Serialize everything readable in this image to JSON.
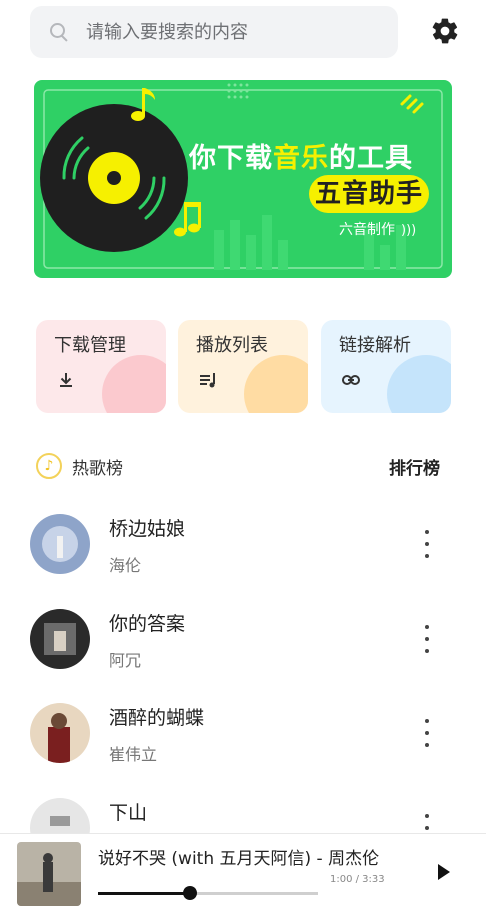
{
  "search": {
    "placeholder": "请输入要搜索的内容"
  },
  "banner": {
    "line1_a": "你下载",
    "line1_b": "音乐",
    "line1_c": "的工具",
    "badge": "五音助手",
    "maker": "六音制作"
  },
  "features": [
    {
      "label": "下载管理",
      "icon": "download-icon"
    },
    {
      "label": "播放列表",
      "icon": "playlist-icon"
    },
    {
      "label": "链接解析",
      "icon": "link-icon"
    }
  ],
  "hot": {
    "title": "热歌榜",
    "rank_link": "排行榜"
  },
  "songs": [
    {
      "name": "桥边姑娘",
      "artist": "海伦"
    },
    {
      "name": "你的答案",
      "artist": "阿冗"
    },
    {
      "name": "酒醉的蝴蝶",
      "artist": "崔伟立"
    },
    {
      "name": "下山",
      "artist": ""
    }
  ],
  "player": {
    "title": "说好不哭 (with 五月天阿信) - 周杰伦",
    "time": "1:00 / 3:33",
    "progress": 0.42
  },
  "colors": {
    "banner_green": "#2fd065",
    "accent_yellow": "#f6f000"
  }
}
